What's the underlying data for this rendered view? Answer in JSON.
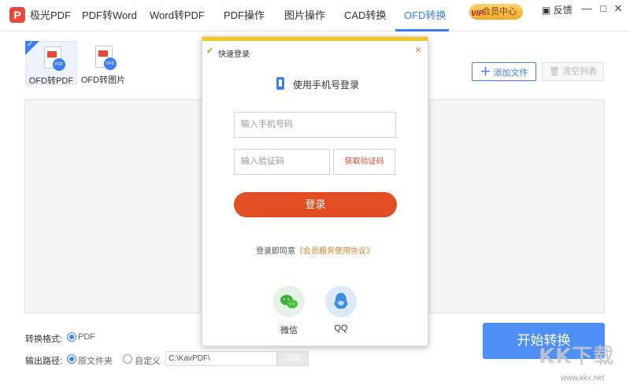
{
  "app": {
    "logo_letter": "P",
    "nav": [
      "极光PDF",
      "PDF转Word",
      "Word转PDF",
      "PDF操作",
      "图片操作",
      "CAD转换",
      "OFD转换"
    ],
    "active_nav": "OFD转换",
    "vip_badge": "会员中心",
    "vip_tag": "VIP",
    "feedback": "反馈",
    "window_controls": [
      "—",
      "□",
      "✕"
    ]
  },
  "tools": {
    "tabs": [
      {
        "label": "OFD转PDF",
        "badge": "PDF",
        "active": true
      },
      {
        "label": "OFD转图片",
        "badge": "OFD",
        "active": false
      }
    ],
    "add_file": "添加文件",
    "clear_list": "清空列表"
  },
  "settings": {
    "format_label": "转换格式:",
    "format_value": "PDF",
    "output_label": "输出路径:",
    "output_original": "原文件夹",
    "output_custom": "自定义",
    "path_value": "C:\\KavPDF\\",
    "browse_label": "浏览",
    "start_button": "开始转换"
  },
  "login_modal": {
    "title": "快速登录",
    "close_icon": "×",
    "header": "使用手机号登录",
    "phone_placeholder": "输入手机号码",
    "code_placeholder": "输入验证码",
    "get_code": "获取验证码",
    "login_button": "登录",
    "agree_prefix": "登录即同意",
    "agree_link": "《会员服务使用协议》",
    "social": [
      {
        "label": "微信",
        "icon": "wechat-icon"
      },
      {
        "label": "QQ",
        "icon": "qq-icon"
      }
    ]
  },
  "watermark": {
    "main": "KK下载",
    "sub": "www.kkx.net"
  },
  "colors": {
    "accent": "#3d7ef5",
    "login": "#e24d22",
    "modal_top": "#f3c624",
    "start": "#4e8ff6"
  }
}
